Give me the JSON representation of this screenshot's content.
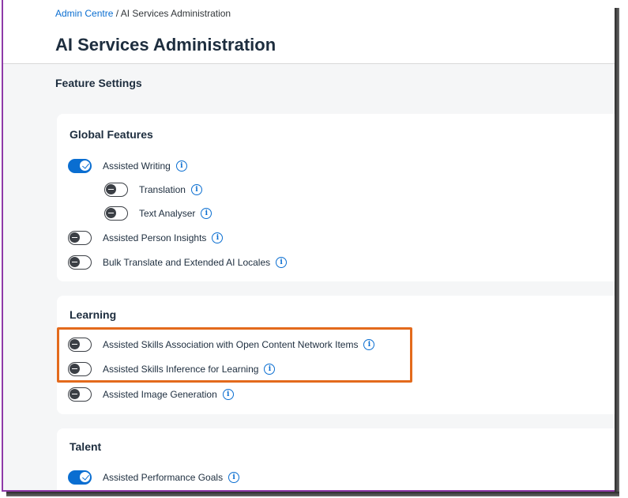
{
  "breadcrumb": {
    "parent": "Admin Centre",
    "separator": " / ",
    "current": "AI Services Administration"
  },
  "page_title": "AI Services Administration",
  "section_title": "Feature Settings",
  "global": {
    "title": "Global Features",
    "items": [
      {
        "label": "Assisted Writing",
        "state": "on"
      },
      {
        "label": "Translation",
        "state": "off"
      },
      {
        "label": "Text Analyser",
        "state": "off"
      },
      {
        "label": "Assisted Person Insights",
        "state": "off"
      },
      {
        "label": "Bulk Translate and Extended AI Locales",
        "state": "off"
      }
    ]
  },
  "learning": {
    "title": "Learning",
    "items": [
      {
        "label": "Assisted Skills Association with Open Content Network Items",
        "state": "off"
      },
      {
        "label": "Assisted Skills Inference for Learning",
        "state": "off"
      },
      {
        "label": "Assisted Image Generation",
        "state": "off"
      }
    ]
  },
  "talent": {
    "title": "Talent",
    "items": [
      {
        "label": "Assisted Performance Goals",
        "state": "on"
      }
    ]
  },
  "info_glyph": "i",
  "colors": {
    "accent": "#0a6ed1",
    "highlight": "#e36a1c",
    "frame": "#8e3aa8"
  }
}
